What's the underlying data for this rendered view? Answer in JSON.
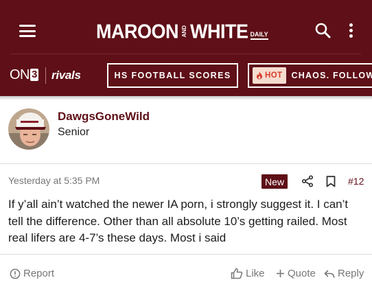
{
  "header": {
    "logo": {
      "maroon": "MAROON",
      "and": "AND",
      "white": "WHITE",
      "daily": "DAILY"
    },
    "brand": {
      "on": "ON",
      "three": "3",
      "rivals": "rivals"
    },
    "nav": {
      "scores_label": "HS FOOTBALL SCORES",
      "hot_badge": "HOT",
      "hot_label": "CHAOS. FOLLOW"
    },
    "icons": [
      "menu-icon",
      "search-icon",
      "kebab-icon",
      "flame-icon"
    ]
  },
  "post": {
    "author": {
      "name": "DawgsGoneWild",
      "title": "Senior"
    },
    "timestamp": "Yesterday at 5:35 PM",
    "new_badge": "New",
    "number": "#12",
    "body": "If y’all ain’t watched the newer IA porn, i strongly suggest it. I can’t tell the difference. Other than all absolute 10’s getting railed. Most real lifers are 4-7’s these days. Most i said",
    "actions": {
      "report": "Report",
      "like": "Like",
      "quote": "Quote",
      "reply": "Reply"
    }
  },
  "colors": {
    "brand": "#5e0f17",
    "hot_bg": "#f6dccf",
    "hot_text": "#d63b2a",
    "muted": "#777777"
  }
}
